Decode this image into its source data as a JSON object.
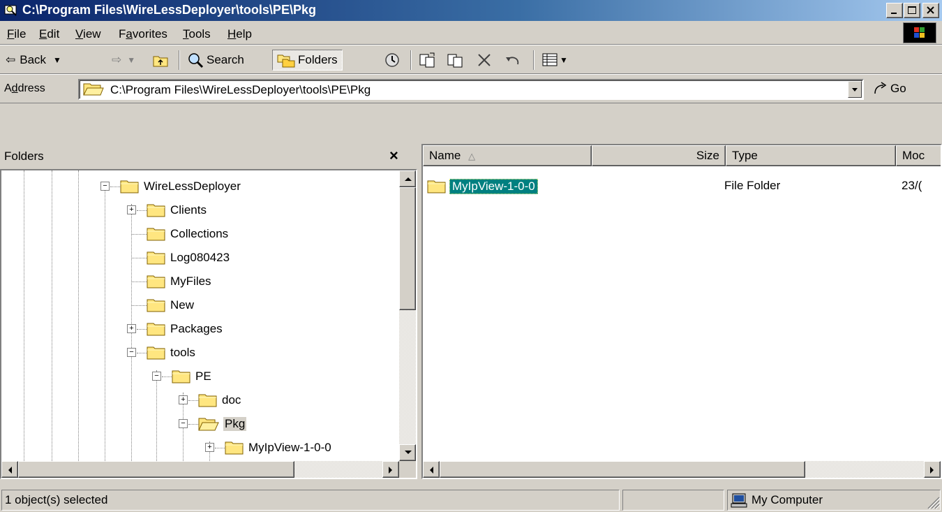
{
  "window": {
    "title": "C:\\Program Files\\WireLessDeployer\\tools\\PE\\Pkg"
  },
  "menu": {
    "items": [
      {
        "label": "File",
        "key": "F",
        "rest": "ile"
      },
      {
        "label": "Edit",
        "key": "E",
        "rest": "dit"
      },
      {
        "label": "View",
        "key": "V",
        "rest": "iew"
      },
      {
        "label": "Favorites",
        "pre": "F",
        "key": "a",
        "rest": "vorites"
      },
      {
        "label": "Tools",
        "key": "T",
        "rest": "ools"
      },
      {
        "label": "Help",
        "key": "H",
        "rest": "elp"
      }
    ]
  },
  "toolbar": {
    "back_label": "Back",
    "search_label": "Search",
    "folders_label": "Folders"
  },
  "address": {
    "label_pre": "A",
    "label_key": "d",
    "label_rest": "dress",
    "value": "C:\\Program Files\\WireLessDeployer\\tools\\PE\\Pkg",
    "go_label": "Go"
  },
  "folders_pane": {
    "title": "Folders",
    "close_glyph": "×",
    "tree": [
      {
        "label": "WireLessDeployer",
        "expander": "minus"
      },
      {
        "label": "Clients",
        "expander": "plus"
      },
      {
        "label": "Collections",
        "expander": "none"
      },
      {
        "label": "Log080423",
        "expander": "none"
      },
      {
        "label": "MyFiles",
        "expander": "none"
      },
      {
        "label": "New",
        "expander": "none"
      },
      {
        "label": "Packages",
        "expander": "plus"
      },
      {
        "label": "tools",
        "expander": "minus"
      },
      {
        "label": "PE",
        "expander": "minus"
      },
      {
        "label": "doc",
        "expander": "plus"
      },
      {
        "label": "Pkg",
        "expander": "minus",
        "selected": true,
        "open": true
      },
      {
        "label": "MyIpView-1-0-0",
        "expander": "plus"
      }
    ]
  },
  "list_pane": {
    "columns": [
      {
        "label": "Name",
        "sort": "ascending"
      },
      {
        "label": "Size"
      },
      {
        "label": "Type"
      },
      {
        "label": "Moc"
      }
    ],
    "rows": [
      {
        "name": "MyIpView-1-0-0",
        "size": "",
        "type": "File Folder",
        "modified": "23/("
      }
    ]
  },
  "status": {
    "left": "1 object(s) selected",
    "middle": "",
    "zone": "My Computer"
  },
  "colors": {
    "title_active": "#0a246a",
    "selection": "#008080",
    "face": "#d4d0c8"
  }
}
